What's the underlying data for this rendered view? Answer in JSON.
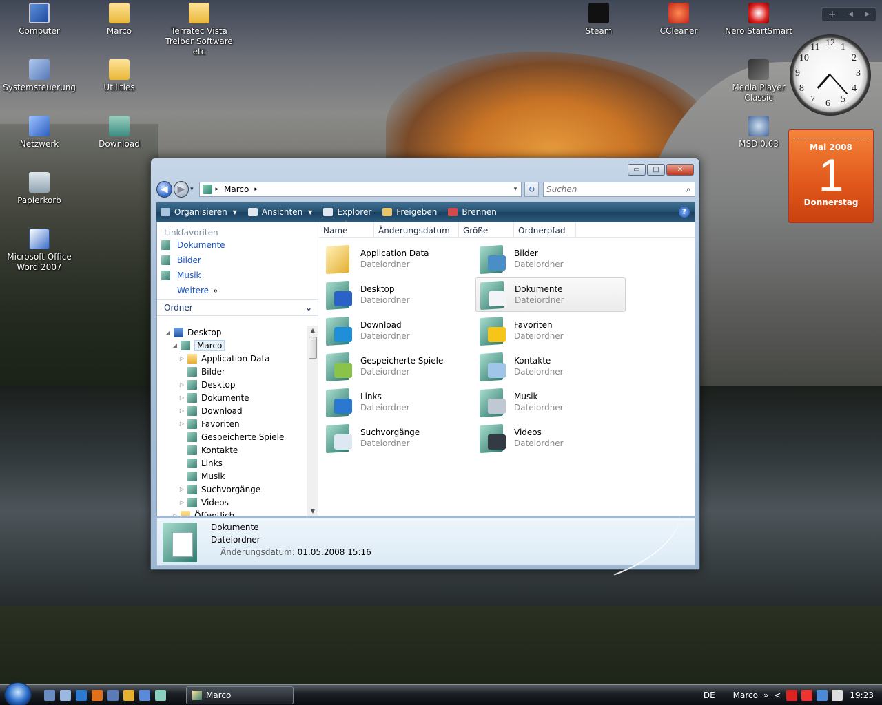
{
  "desktop": {
    "icons": [
      {
        "label": "Computer",
        "type": "ico-pc"
      },
      {
        "label": "Marco",
        "type": "ico-folder"
      },
      {
        "label": "Terratec Vista Treiber Software etc",
        "type": "ico-folder"
      },
      {
        "label": "Systemsteuerung",
        "type": "ico-cp"
      },
      {
        "label": "Utilities",
        "type": "ico-folder"
      },
      {
        "label": "Netzwerk",
        "type": "ico-net"
      },
      {
        "label": "Download",
        "type": "ico-dl"
      },
      {
        "label": "Papierkorb",
        "type": "ico-bin"
      },
      {
        "label": "Microsoft Office Word 2007",
        "type": "ico-word"
      },
      {
        "label": "Steam",
        "type": "ico-steam"
      },
      {
        "label": "CCleaner",
        "type": "ico-ccl"
      },
      {
        "label": "Nero StartSmart",
        "type": "ico-nero"
      },
      {
        "label": "Media Player Classic",
        "type": "ico-mpc"
      },
      {
        "label": "MSD 0.63",
        "type": "ico-msd"
      }
    ]
  },
  "gadgets": {
    "bar": {
      "add": "+",
      "prev": "◀",
      "next": "▶"
    },
    "clock": {
      "numbers": [
        "12",
        "1",
        "2",
        "3",
        "4",
        "5",
        "6",
        "7",
        "8",
        "9",
        "10",
        "11"
      ],
      "time_shown": "7:23"
    },
    "calendar": {
      "month_year": "Mai 2008",
      "day": "1",
      "weekday": "Donnerstag"
    }
  },
  "window": {
    "controls": {
      "minimize": "▭",
      "maximize": "□",
      "close": "✕"
    },
    "nav": {
      "back": "◀",
      "forward": "▶",
      "history": "▾"
    },
    "address": {
      "sep": "▸",
      "path": "Marco",
      "sep2": "▸",
      "dropdown": "▾",
      "refresh": "↻"
    },
    "search": {
      "placeholder": "Suchen",
      "icon": "search-icon"
    },
    "toolbar": [
      {
        "label": "Organisieren",
        "dropdown": true,
        "icon": "organize-icon",
        "color": "#a9c4e0"
      },
      {
        "label": "Ansichten",
        "dropdown": true,
        "icon": "views-icon",
        "color": "#dfe8f0"
      },
      {
        "label": "Explorer",
        "dropdown": false,
        "icon": "explorer-icon",
        "color": "#dfe8f0"
      },
      {
        "label": "Freigeben",
        "dropdown": false,
        "icon": "share-icon",
        "color": "#e8c46a"
      },
      {
        "label": "Brennen",
        "dropdown": false,
        "icon": "burn-icon",
        "color": "#d24a4a"
      }
    ],
    "help": "?",
    "favorites_header": "Linkfavoriten",
    "favorites": [
      "Dokumente",
      "Bilder",
      "Musik"
    ],
    "favorites_more": "Weitere",
    "favorites_more_chev": "»",
    "ordner_label": "Ordner",
    "ordner_chev": "⌄",
    "tree": [
      {
        "label": "Desktop",
        "level": 0,
        "exp": "◢",
        "kind": "desk"
      },
      {
        "label": "Marco",
        "level": 1,
        "exp": "◢",
        "kind": "lib",
        "selected": true
      },
      {
        "label": "Application Data",
        "level": 2,
        "exp": "▷",
        "kind": "fold"
      },
      {
        "label": "Bilder",
        "level": 2,
        "exp": "",
        "kind": "lib"
      },
      {
        "label": "Desktop",
        "level": 2,
        "exp": "▷",
        "kind": "lib"
      },
      {
        "label": "Dokumente",
        "level": 2,
        "exp": "▷",
        "kind": "lib"
      },
      {
        "label": "Download",
        "level": 2,
        "exp": "▷",
        "kind": "lib"
      },
      {
        "label": "Favoriten",
        "level": 2,
        "exp": "▷",
        "kind": "lib"
      },
      {
        "label": "Gespeicherte Spiele",
        "level": 2,
        "exp": "",
        "kind": "lib"
      },
      {
        "label": "Kontakte",
        "level": 2,
        "exp": "",
        "kind": "lib"
      },
      {
        "label": "Links",
        "level": 2,
        "exp": "",
        "kind": "lib"
      },
      {
        "label": "Musik",
        "level": 2,
        "exp": "",
        "kind": "lib"
      },
      {
        "label": "Suchvorgänge",
        "level": 2,
        "exp": "▷",
        "kind": "lib"
      },
      {
        "label": "Videos",
        "level": 2,
        "exp": "▷",
        "kind": "lib"
      },
      {
        "label": "Öffentlich",
        "level": 1,
        "exp": "▷",
        "kind": "fold"
      }
    ],
    "scroll": {
      "up": "▲",
      "down": "▼"
    },
    "columns": {
      "name": "Name",
      "sort": "^",
      "date": "Änderungsdatum",
      "size": "Größe",
      "path": "Ordnerpfad"
    },
    "items": [
      {
        "name": "Application Data",
        "type": "Dateiordner",
        "folder": "yellow",
        "overlay": ""
      },
      {
        "name": "Bilder",
        "type": "Dateiordner",
        "folder": "teal",
        "overlay": "#4a8ec8"
      },
      {
        "name": "Desktop",
        "type": "Dateiordner",
        "folder": "teal",
        "overlay": "#2a62c8"
      },
      {
        "name": "Dokumente",
        "type": "Dateiordner",
        "folder": "teal",
        "overlay": "#f2f4f8",
        "selected": true
      },
      {
        "name": "Download",
        "type": "Dateiordner",
        "folder": "teal",
        "overlay": "#1f8fd8"
      },
      {
        "name": "Favoriten",
        "type": "Dateiordner",
        "folder": "teal",
        "overlay": "#f5c518"
      },
      {
        "name": "Gespeicherte Spiele",
        "type": "Dateiordner",
        "folder": "teal",
        "overlay": "#8bc34a"
      },
      {
        "name": "Kontakte",
        "type": "Dateiordner",
        "folder": "teal",
        "overlay": "#9fc6e8"
      },
      {
        "name": "Links",
        "type": "Dateiordner",
        "folder": "teal",
        "overlay": "#2a78d0"
      },
      {
        "name": "Musik",
        "type": "Dateiordner",
        "folder": "teal",
        "overlay": "#c0c8d4"
      },
      {
        "name": "Suchvorgänge",
        "type": "Dateiordner",
        "folder": "teal",
        "overlay": "#dde8f2"
      },
      {
        "name": "Videos",
        "type": "Dateiordner",
        "folder": "teal",
        "overlay": "#333a44"
      }
    ],
    "details": {
      "name": "Dokumente",
      "type": "Dateiordner",
      "date_label": "Änderungsdatum:",
      "date_value": "01.05.2008 15:16"
    }
  },
  "taskbar": {
    "task": "Marco",
    "lang": "DE",
    "user": "Marco",
    "more": "»",
    "arrow": "<",
    "time": "19:23",
    "quicklaunch": [
      "#6a8cc0",
      "#9ab8e0",
      "#2a7ad0",
      "#e0701a",
      "#5a7ab8",
      "#e8b030",
      "#5a8ad8",
      "#8ad0c0"
    ],
    "trayicons": [
      "#d22",
      "#e33",
      "#4a8ad8",
      "#ddd"
    ]
  }
}
